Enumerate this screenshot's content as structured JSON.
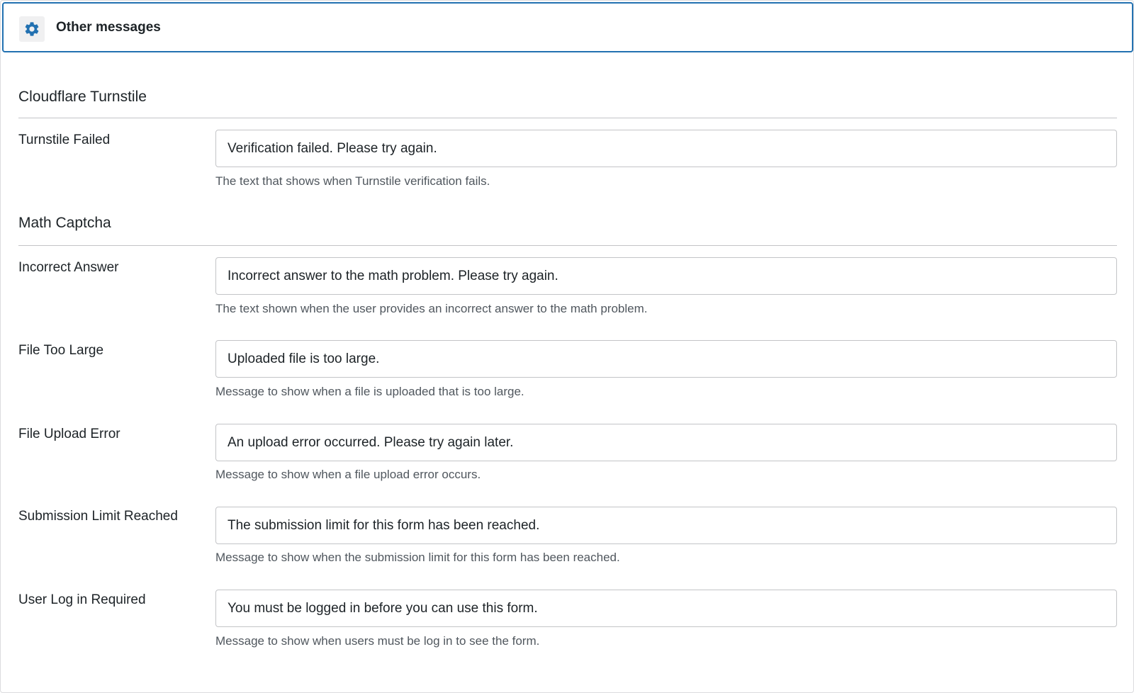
{
  "header": {
    "title": "Other messages",
    "icon": "gear-icon",
    "icon_color": "#2271b1"
  },
  "sections": [
    {
      "heading": "Cloudflare Turnstile",
      "fields": [
        {
          "label": "Turnstile Failed",
          "value": "Verification failed. Please try again.",
          "description": "The text that shows when Turnstile verification fails."
        }
      ]
    },
    {
      "heading": "Math Captcha",
      "fields": [
        {
          "label": "Incorrect Answer",
          "value": "Incorrect answer to the math problem. Please try again.",
          "description": "The text shown when the user provides an incorrect answer to the math problem."
        },
        {
          "label": "File Too Large",
          "value": "Uploaded file is too large.",
          "description": "Message to show when a file is uploaded that is too large."
        },
        {
          "label": "File Upload Error",
          "value": "An upload error occurred. Please try again later.",
          "description": "Message to show when a file upload error occurs."
        },
        {
          "label": "Submission Limit Reached",
          "value": "The submission limit for this form has been reached.",
          "description": "Message to show when the submission limit for this form has been reached."
        },
        {
          "label": "User Log in Required",
          "value": "You must be logged in before you can use this form.",
          "description": "Message to show when users must be log in to see the form."
        }
      ]
    }
  ]
}
